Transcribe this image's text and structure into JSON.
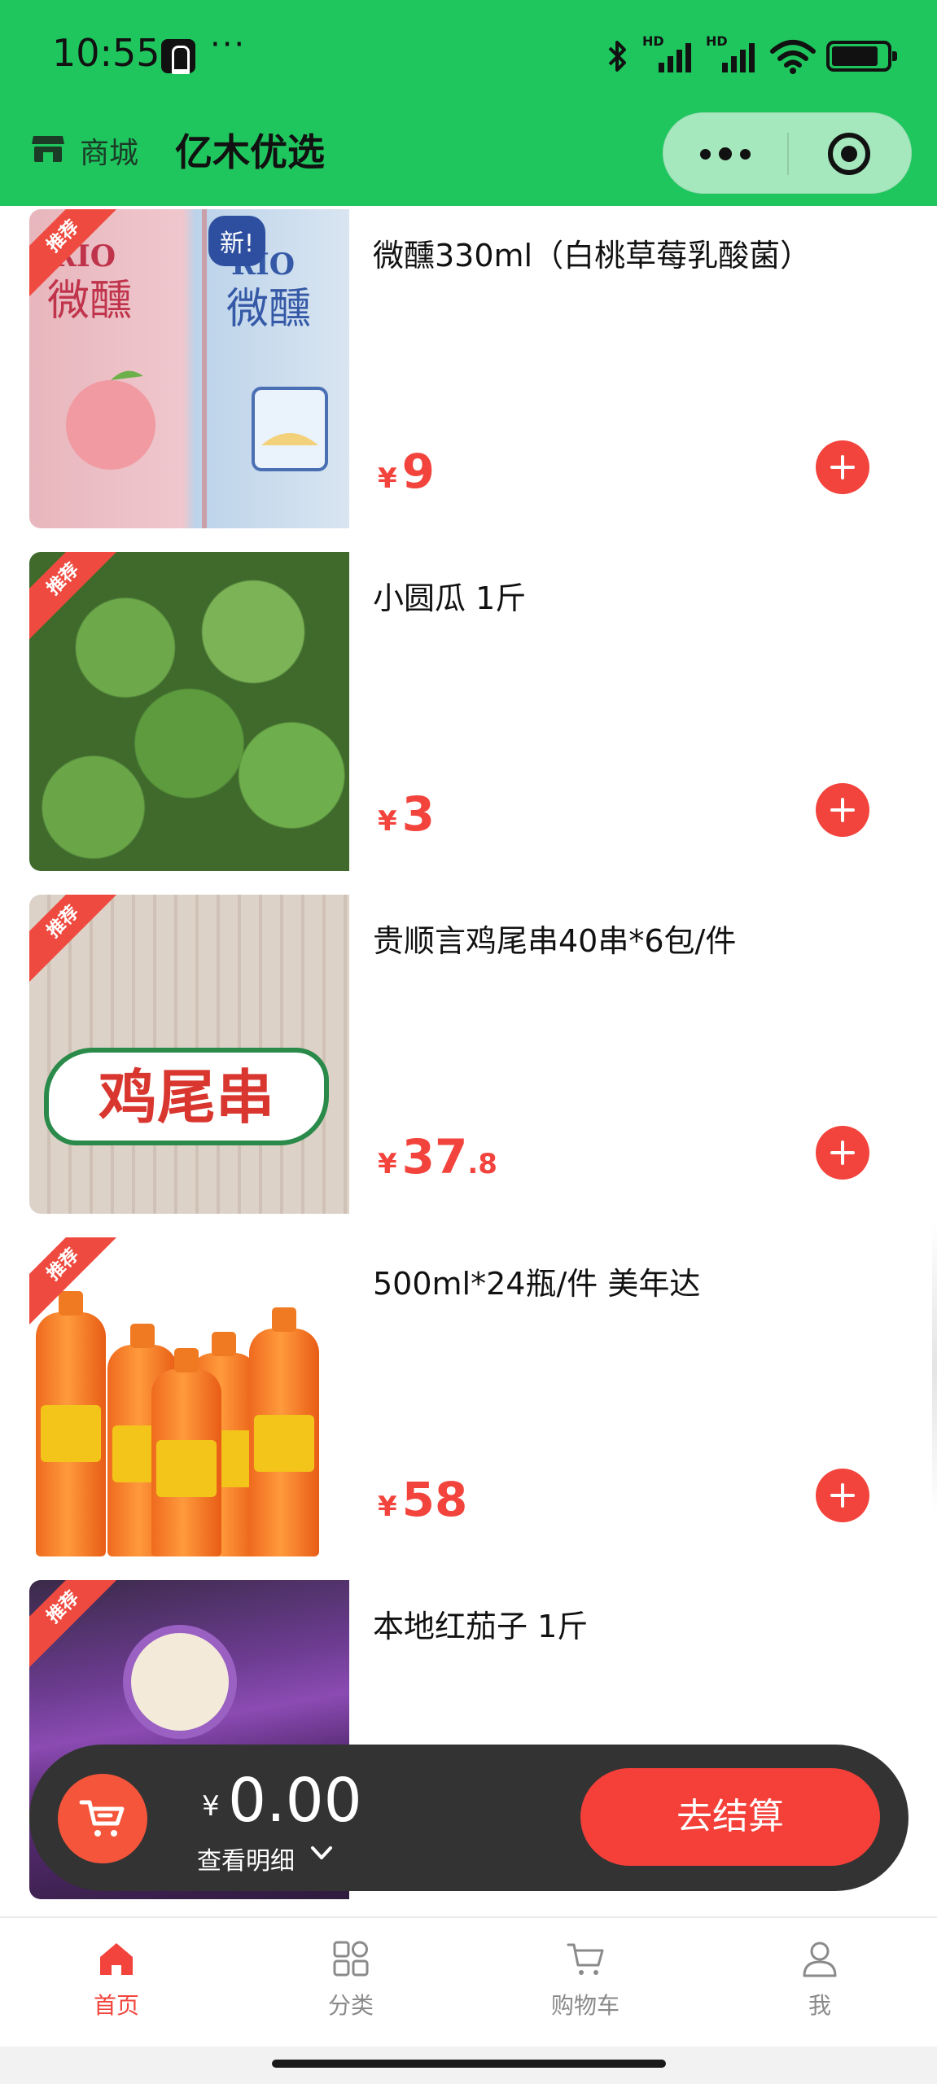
{
  "status_bar": {
    "time": "10:55",
    "dots": "···",
    "bluetooth_icon": "bluetooth-icon",
    "signal_labels": [
      "HD",
      "HD"
    ]
  },
  "navbar": {
    "store_label": "商城",
    "title": "亿木优选"
  },
  "products": [
    {
      "name": "微醺330ml（白桃草莓乳酸菌）",
      "currency": "¥",
      "price_int": "9",
      "price_dec": "",
      "tag": "推荐",
      "image": "rio-cocktail-cans"
    },
    {
      "name": "小圆瓜 1斤",
      "currency": "¥",
      "price_int": "3",
      "price_dec": "",
      "tag": "推荐",
      "image": "round-zucchini"
    },
    {
      "name": "贵顺言鸡尾串40串*6包/件",
      "currency": "¥",
      "price_int": "37",
      "price_dec": ".8",
      "tag": "推荐",
      "image": "chicken-tail-skewers",
      "image_text": "鸡尾串"
    },
    {
      "name": "500ml*24瓶/件 美年达",
      "currency": "¥",
      "price_int": "58",
      "price_dec": "",
      "tag": "推荐",
      "image": "mirinda-orange-bottles"
    },
    {
      "name": "本地红茄子 1斤",
      "currency": "¥",
      "price_int": "",
      "price_dec": "",
      "tag": "推荐",
      "image": "purple-eggplant"
    }
  ],
  "cart": {
    "currency": "¥",
    "total": "0.00",
    "detail_label": "查看明细",
    "checkout_label": "去结算"
  },
  "tabbar": {
    "items": [
      {
        "label": "首页",
        "icon": "home-icon",
        "active": true
      },
      {
        "label": "分类",
        "icon": "category-grid-icon",
        "active": false
      },
      {
        "label": "购物车",
        "icon": "shopping-cart-icon",
        "active": false
      },
      {
        "label": "我",
        "icon": "user-icon",
        "active": false
      }
    ]
  },
  "colors": {
    "header_green": "#1fc65e",
    "accent_red": "#f2443c",
    "cart_bar": "#333333"
  }
}
